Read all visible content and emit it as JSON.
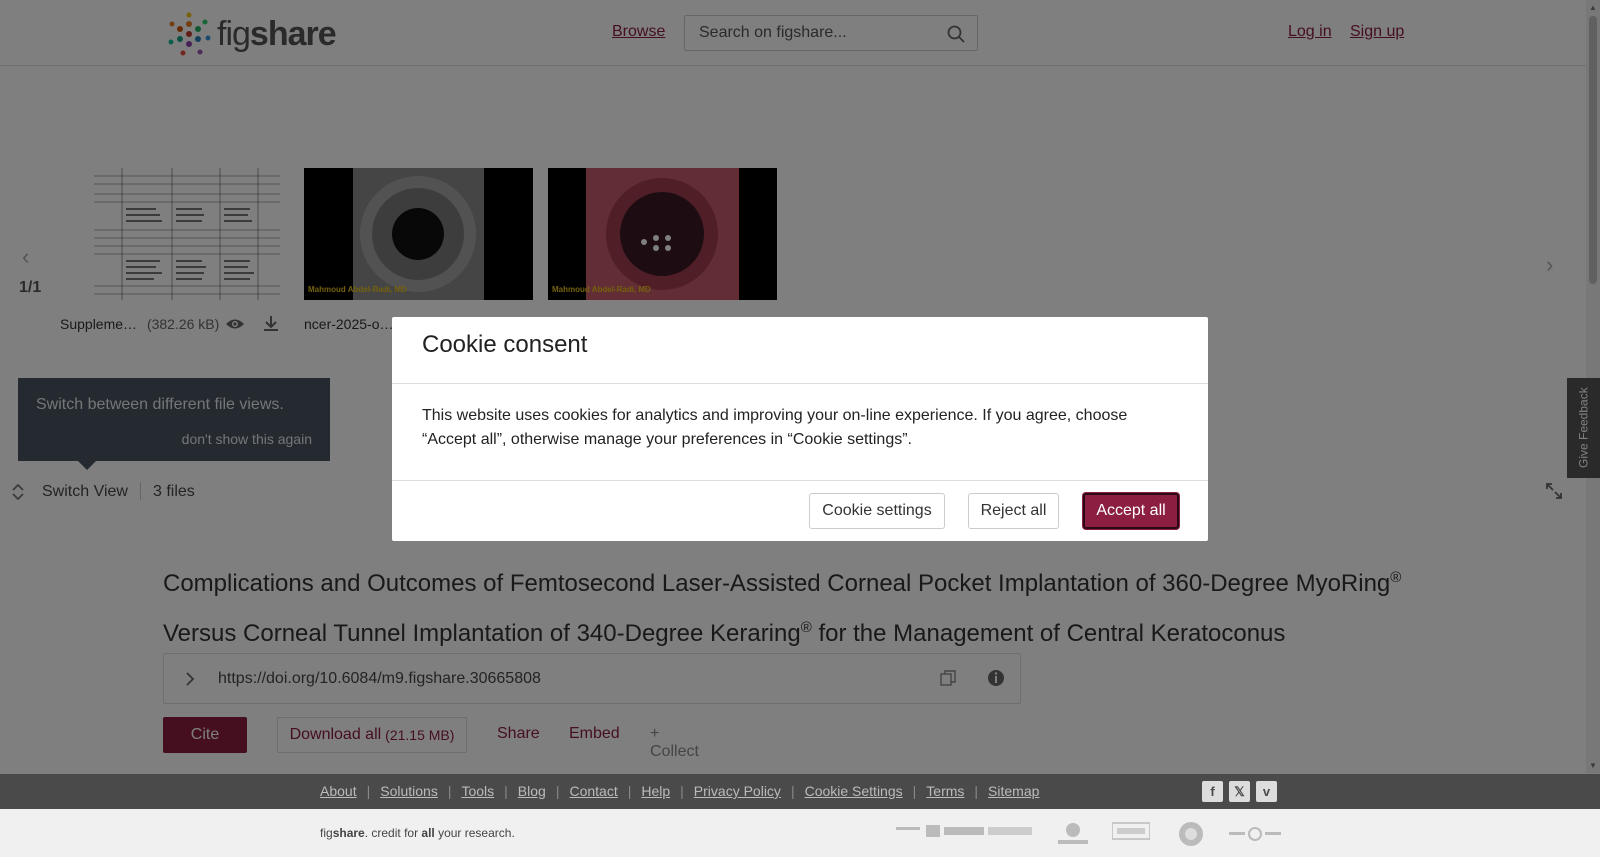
{
  "header": {
    "logo_fig": "fig",
    "logo_share": "share",
    "browse": "Browse",
    "search_placeholder": "Search on figshare...",
    "login": "Log in",
    "signup": "Sign up"
  },
  "viewer": {
    "counter": "1/1",
    "files": [
      {
        "name": "Suppleme…",
        "size": "(382.26 kB)"
      },
      {
        "name": "ncer-2025-o…",
        "size": ""
      },
      {
        "name": "",
        "size": ""
      }
    ],
    "watermarks": [
      "Mahmoud Abdel-Radi, MD",
      "Mahmoud Abdel-Radi, MD"
    ],
    "tooltip_text": "Switch between different file views.",
    "tooltip_dismiss": "don't show this again",
    "switch_view": "Switch View",
    "files_count": "3 files"
  },
  "feedback": "Give Feedback",
  "article": {
    "title_part1": "Complications and Outcomes of Femtosecond Laser-Assisted Corneal Pocket Implantation of 360-Degree MyoRing",
    "title_reg": "®",
    "title_part2": " Versus Corneal Tunnel Implantation of 340-Degree Keraring",
    "title_part3": " for the Management of Central Keratoconus",
    "doi": "https://doi.org/10.6084/m9.figshare.30665808",
    "cite": "Cite",
    "download": "Download all",
    "download_size": "(21.15 MB)",
    "share": "Share",
    "embed": "Embed",
    "collect": "+ Collect"
  },
  "cookie": {
    "title": "Cookie consent",
    "body": "This website uses cookies for analytics and improving your on-line experience. If you agree, choose “Accept all”, otherwise manage your preferences in “Cookie settings”.",
    "settings": "Cookie settings",
    "reject": "Reject all",
    "accept": "Accept all"
  },
  "footer": {
    "links": [
      "About",
      "Solutions",
      "Tools",
      "Blog",
      "Contact",
      "Help",
      "Privacy Policy",
      "Cookie Settings",
      "Terms",
      "Sitemap"
    ],
    "tagline_fig": "fig",
    "tagline_share": "share",
    "tagline_mid": ". credit for ",
    "tagline_all": "all",
    "tagline_end": " your research.",
    "social": [
      "facebook-icon",
      "x-icon",
      "vimeo-icon"
    ]
  },
  "colors": {
    "accent": "#8b1e41",
    "footer_dark": "#4a4a4a"
  }
}
